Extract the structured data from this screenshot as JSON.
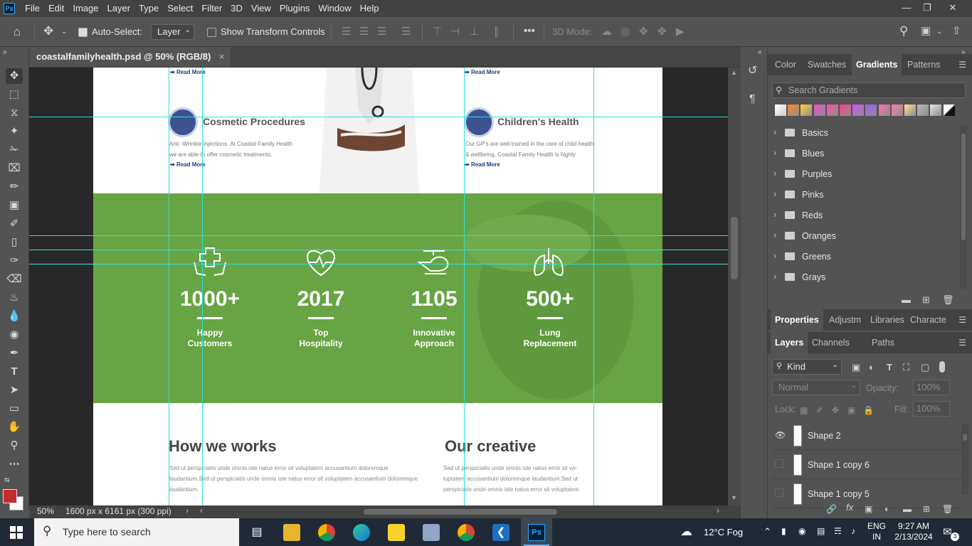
{
  "menu": [
    "File",
    "Edit",
    "Image",
    "Layer",
    "Type",
    "Select",
    "Filter",
    "3D",
    "View",
    "Plugins",
    "Window",
    "Help"
  ],
  "app_logo": "Ps",
  "options": {
    "auto_select_label": "Auto-Select:",
    "auto_select_value": "Layer",
    "show_transform_label": "Show Transform Controls",
    "mode_3d_label": "3D Mode:"
  },
  "document": {
    "tab_title": "coastalfamilyhealth.psd @ 50% (RGB/8)",
    "zoom": "50%",
    "doc_info": "1600 px x 6161 px (300 ppi)",
    "content": {
      "read_more": "Read More",
      "services": [
        {
          "title": "Cosmetic Procedures",
          "text_line1": "Anti -Wrinkle Injections. At Coastal Family Health",
          "text_line2": "we are able to offer cosmetic treatments."
        },
        {
          "title": "Children's Health",
          "text_line1": "Our GP's are well trained in the care of child health",
          "text_line2": "& wellbeing. Coastal Family Health is highly."
        }
      ],
      "stats": [
        {
          "number": "1000+",
          "label_line1": "Happy",
          "label_line2": "Customers",
          "icon": "hands-cross-icon"
        },
        {
          "number": "2017",
          "label_line1": "Top",
          "label_line2": "Hospitality",
          "icon": "heart-pulse-icon"
        },
        {
          "number": "1105",
          "label_line1": "Innovative",
          "label_line2": "Approach",
          "icon": "helicopter-icon"
        },
        {
          "number": "500+",
          "label_line1": "Lung",
          "label_line2": "Replacement",
          "icon": "lungs-icon"
        }
      ],
      "sections": [
        {
          "title": "How we works",
          "lines": [
            "Sed ut perspiciatis unde omnis iste natus error sit voluptatem accusantium doloremque",
            "laudantium.Sed ut perspiciatis unde omnis iste natus error sit voluptatem accusantium doloremque",
            "laudantium."
          ]
        },
        {
          "title": "Our creative",
          "lines": [
            "Sed ut perspiciatis unde omnis iste natus error sit vo-",
            "luptatem accusantium doloremque laudantium.Sed ut",
            "perspiciatis unde omnis iste natus error sit voluptatem"
          ]
        }
      ]
    }
  },
  "gradients_panel": {
    "tabs": [
      "Color",
      "Swatches",
      "Gradients",
      "Patterns"
    ],
    "active_tab": "Gradients",
    "search_placeholder": "Search Gradients",
    "swatch_colors": [
      "#f0f0f0",
      "#ff8a1f",
      "#ffd23a",
      "#e84fd0",
      "#ff4fa8",
      "#ff3f8a",
      "#d94fff",
      "#a15cff",
      "#ff6fb8",
      "#ff7fb0",
      "#ffe28a",
      "#b9b9b9",
      "#e8e8e8",
      "#111111"
    ],
    "folders": [
      "Basics",
      "Blues",
      "Purples",
      "Pinks",
      "Reds",
      "Oranges",
      "Greens",
      "Grays"
    ]
  },
  "properties_tabs": [
    "Properties",
    "Adjustm",
    "Libraries",
    "Characte"
  ],
  "layers_panel": {
    "tabs": [
      "Layers",
      "Channels",
      "Paths"
    ],
    "filter_kind": "Kind",
    "blend_mode": "Normal",
    "opacity_label": "Opacity:",
    "opacity_value": "100%",
    "lock_label": "Lock:",
    "fill_label": "Fill:",
    "fill_value": "100%",
    "layers": [
      "Shape 2",
      "Shape 1 copy 6",
      "Shape 1 copy 5"
    ]
  },
  "taskbar": {
    "search_placeholder": "Type here to search",
    "weather": "12°C  Fog",
    "lang_line1": "ENG",
    "lang_line2": "IN",
    "time": "9:27 AM",
    "date": "2/13/2024",
    "notification_count": "3"
  },
  "colors": {
    "foreground": "#c62a2a",
    "background": "#ffffff",
    "canvas_green": "#67a444",
    "guide": "#2de0e0"
  }
}
